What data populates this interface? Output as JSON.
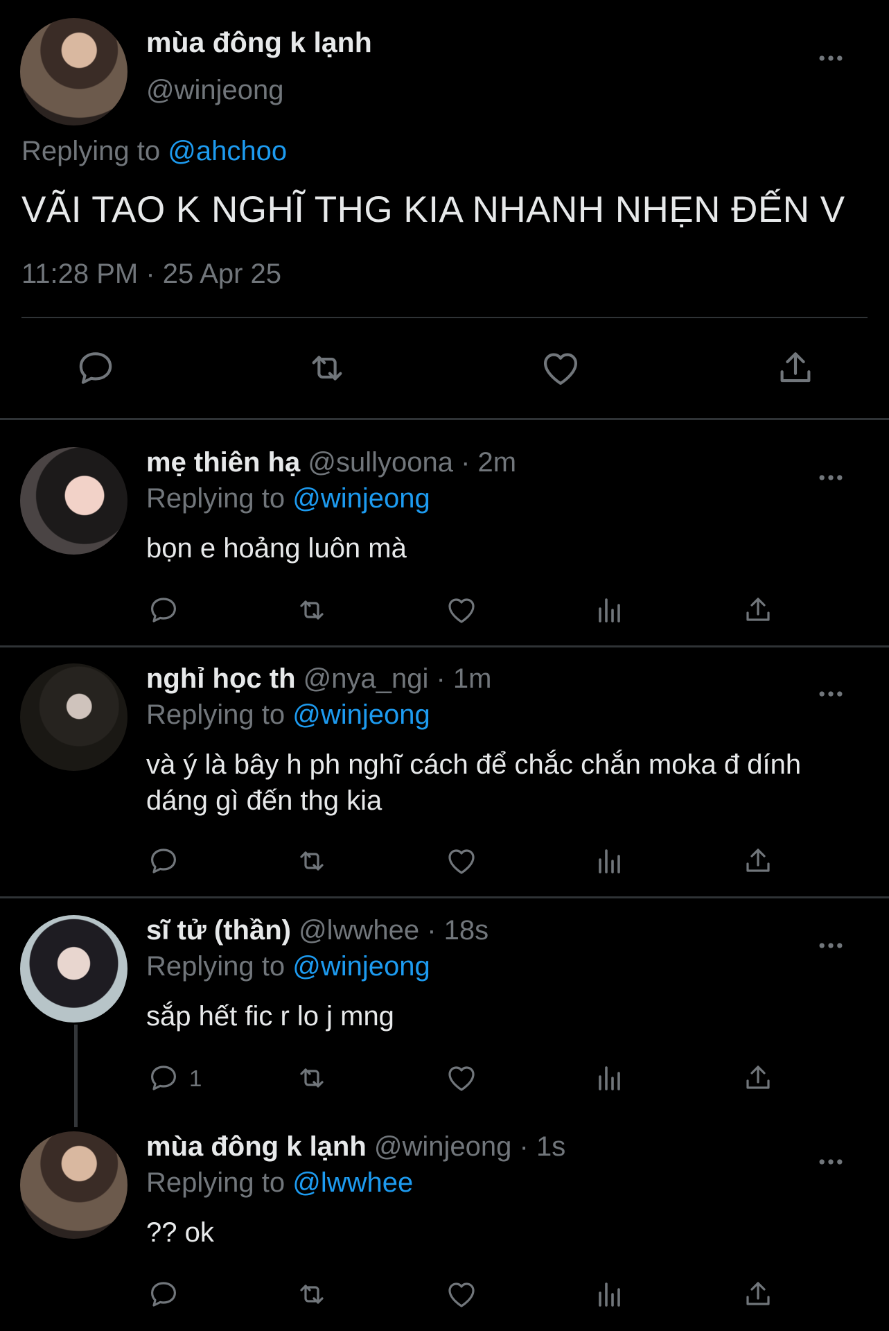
{
  "main_tweet": {
    "name": "mùa đông k lạnh",
    "handle": "@winjeong",
    "replying_prefix": "Replying to ",
    "replying_to": "@ahchoo",
    "text": "VÃI TAO K NGHĨ THG KIA NHANH NHẸN ĐẾN V",
    "timestamp": "11:28 PM · 25 Apr 25",
    "actions": [
      "reply-icon",
      "retweet-icon",
      "like-icon",
      "share-icon"
    ]
  },
  "replies": [
    {
      "name": "mẹ thiên hạ",
      "handle": "@sullyoona",
      "time": "· 2m",
      "replying_prefix": "Replying to ",
      "replying_to": "@winjeong",
      "text": "bọn e hoảng luôn mà",
      "reply_count": ""
    },
    {
      "name": "nghỉ học th",
      "handle": "@nya_ngi",
      "time": "· 1m",
      "replying_prefix": "Replying to ",
      "replying_to": "@winjeong",
      "text": "và ý là bây h ph nghĩ cách để chắc chắn moka đ dính dáng gì đến thg kia",
      "reply_count": ""
    },
    {
      "name": "sĩ tử (thần)",
      "handle": "@lwwhee",
      "time": "· 18s",
      "replying_prefix": "Replying to ",
      "replying_to": "@winjeong",
      "text": "sắp hết fic r lo j mng",
      "reply_count": "1"
    },
    {
      "name": "mùa đông k lạnh",
      "handle": "@winjeong",
      "time": "· 1s",
      "replying_prefix": "Replying to ",
      "replying_to": "@lwwhee",
      "text": "?? ok",
      "reply_count": ""
    }
  ],
  "colors": {
    "background": "#000000",
    "text": "#e7e9ea",
    "muted": "#71767b",
    "link": "#1d9bf0",
    "divider": "#2f3336"
  }
}
